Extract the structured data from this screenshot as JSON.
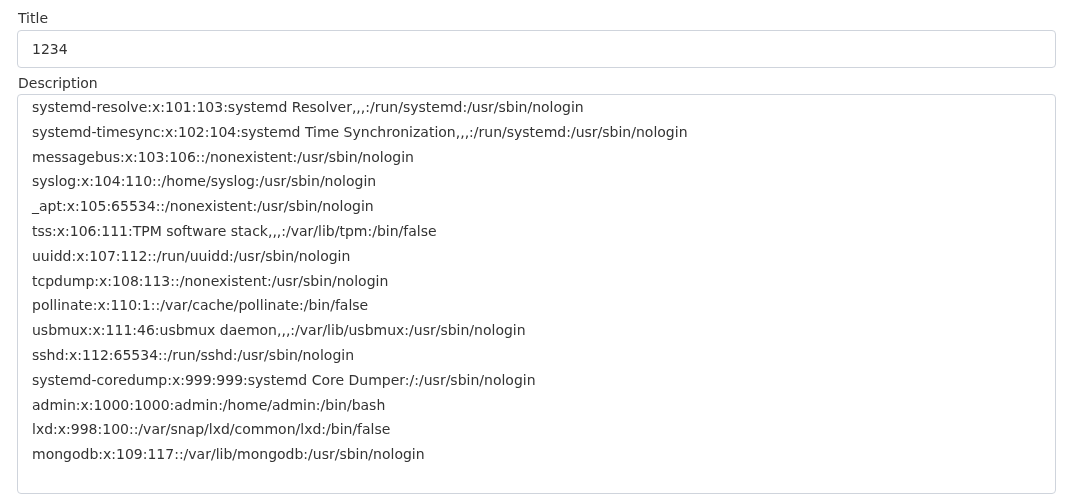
{
  "title_field": {
    "label": "Title",
    "value": "1234"
  },
  "description_field": {
    "label": "Description",
    "lines": [
      "systemd-resolve:x:101:103:systemd Resolver,,,:/run/systemd:/usr/sbin/nologin",
      "systemd-timesync:x:102:104:systemd Time Synchronization,,,:/run/systemd:/usr/sbin/nologin",
      "messagebus:x:103:106::/nonexistent:/usr/sbin/nologin",
      "syslog:x:104:110::/home/syslog:/usr/sbin/nologin",
      "_apt:x:105:65534::/nonexistent:/usr/sbin/nologin",
      "tss:x:106:111:TPM software stack,,,:/var/lib/tpm:/bin/false",
      "uuidd:x:107:112::/run/uuidd:/usr/sbin/nologin",
      "tcpdump:x:108:113::/nonexistent:/usr/sbin/nologin",
      "pollinate:x:110:1::/var/cache/pollinate:/bin/false",
      "usbmux:x:111:46:usbmux daemon,,,:/var/lib/usbmux:/usr/sbin/nologin",
      "sshd:x:112:65534::/run/sshd:/usr/sbin/nologin",
      "systemd-coredump:x:999:999:systemd Core Dumper:/:/usr/sbin/nologin",
      "admin:x:1000:1000:admin:/home/admin:/bin/bash",
      "lxd:x:998:100::/var/snap/lxd/common/lxd:/bin/false",
      "mongodb:x:109:117::/var/lib/mongodb:/usr/sbin/nologin"
    ]
  }
}
